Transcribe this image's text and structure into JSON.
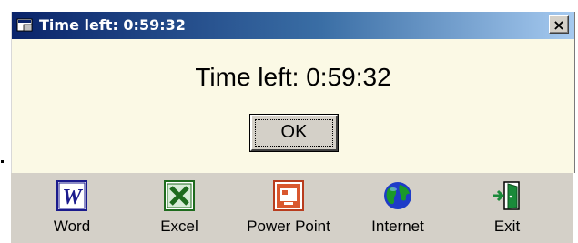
{
  "window": {
    "title": "Time left: 0:59:32",
    "close_glyph": "×"
  },
  "dialog": {
    "message": "Time left:  0:59:32",
    "ok_label": "OK"
  },
  "taskbar": {
    "items": [
      {
        "label": "Word",
        "icon": "word-icon"
      },
      {
        "label": "Excel",
        "icon": "excel-icon"
      },
      {
        "label": "Power Point",
        "icon": "powerpoint-icon"
      },
      {
        "label": "Internet",
        "icon": "internet-icon"
      },
      {
        "label": "Exit",
        "icon": "exit-icon"
      }
    ]
  },
  "colors": {
    "titlebar_start": "#0a246a",
    "titlebar_end": "#a6caf0",
    "dialog_bg": "#fbf9e5",
    "taskbar_bg": "#d4d0c8"
  }
}
